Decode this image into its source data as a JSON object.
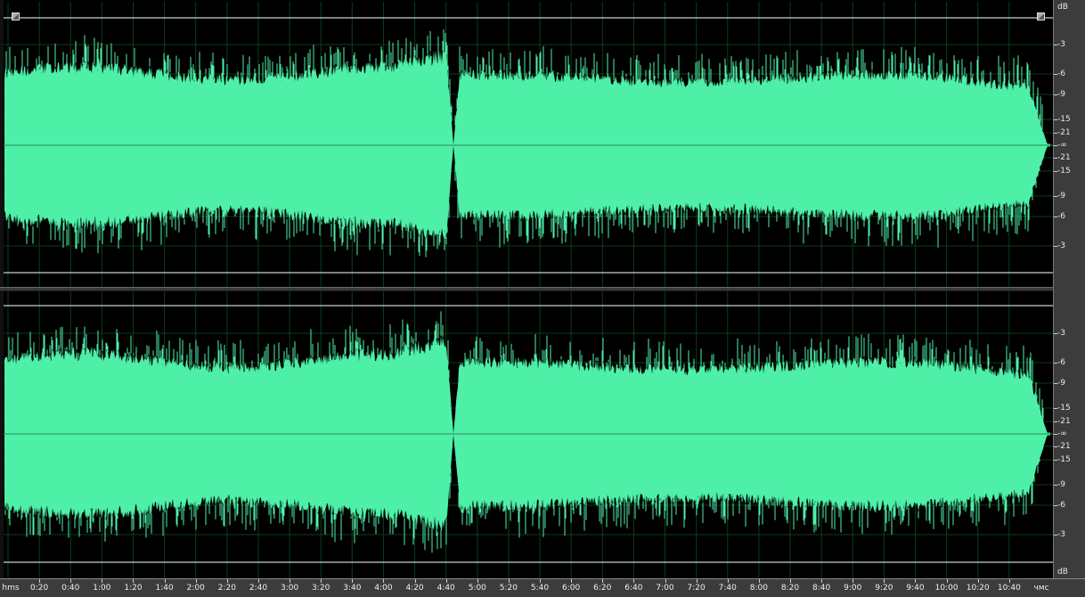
{
  "app": {
    "view": "waveform-editor"
  },
  "colors": {
    "waveform": "#4ef0a8",
    "background": "#000000",
    "grid": "#0d3d1a",
    "level_line": "#ffffff",
    "center_line": "#2a8a4a"
  },
  "db_ruler": {
    "unit": "dB",
    "channel1": [
      "-3",
      "-6",
      "-9",
      "-15",
      "-21",
      "-∞",
      "-21",
      "-15",
      "-9",
      "-6",
      "-3"
    ],
    "channel2": [
      "-3",
      "-6",
      "-9",
      "-15",
      "-21",
      "-∞",
      "-21",
      "-15",
      "-9",
      "-6",
      "-3"
    ]
  },
  "db_unit_bottom": "dB",
  "time_ruler": {
    "labels": [
      "0:20",
      "0:40",
      "1:00",
      "1:20",
      "1:40",
      "2:00",
      "2:20",
      "2:40",
      "3:00",
      "3:20",
      "3:40",
      "4:00",
      "4:20",
      "4:40",
      "5:00",
      "5:20",
      "5:40",
      "6:00",
      "6:20",
      "6:40",
      "7:00",
      "7:20",
      "7:40",
      "8:00",
      "8:20",
      "8:40",
      "9:00",
      "9:20",
      "9:40",
      "10:00",
      "10:20",
      "10:40"
    ],
    "unit_left": "hms",
    "unit_right": "чмс"
  },
  "icons": {
    "left_handle": "fade-in-handle-icon",
    "right_handle": "fade-out-handle-icon"
  }
}
